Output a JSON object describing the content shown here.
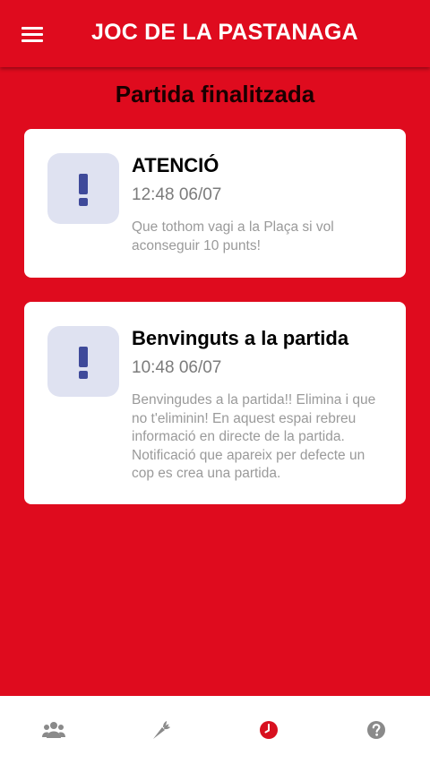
{
  "header": {
    "title": "JOC DE LA PASTANAGA",
    "menu_icon": "hamburger-menu-icon"
  },
  "page": {
    "title": "Partida finalitzada"
  },
  "notifications": [
    {
      "title": "ATENCIÓ",
      "time": "12:48 06/07",
      "message": "Que tothom vagi a la Plaça si vol aconseguir 10 punts!",
      "icon": "exclamation-icon"
    },
    {
      "title": "Benvinguts a la partida",
      "time": "10:48 06/07",
      "message": "Benvingudes a la partida!! Elimina i que no t'eliminin! En aquest espai rebreu informació en directe de la partida. Notificació que apareix per defecte un cop es crea una partida.",
      "icon": "exclamation-icon"
    }
  ],
  "bottom_nav": [
    {
      "icon": "group-icon",
      "active": false
    },
    {
      "icon": "carrot-icon",
      "active": false
    },
    {
      "icon": "clock-icon",
      "active": true
    },
    {
      "icon": "help-icon",
      "active": false
    }
  ],
  "colors": {
    "primary": "#df0b1e",
    "card": "#ffffff",
    "alert_bg": "#dfe2f1",
    "alert_icon": "#3f4a9a",
    "nav_icon": "#8a8a8a",
    "nav_active": "#d8101f"
  }
}
